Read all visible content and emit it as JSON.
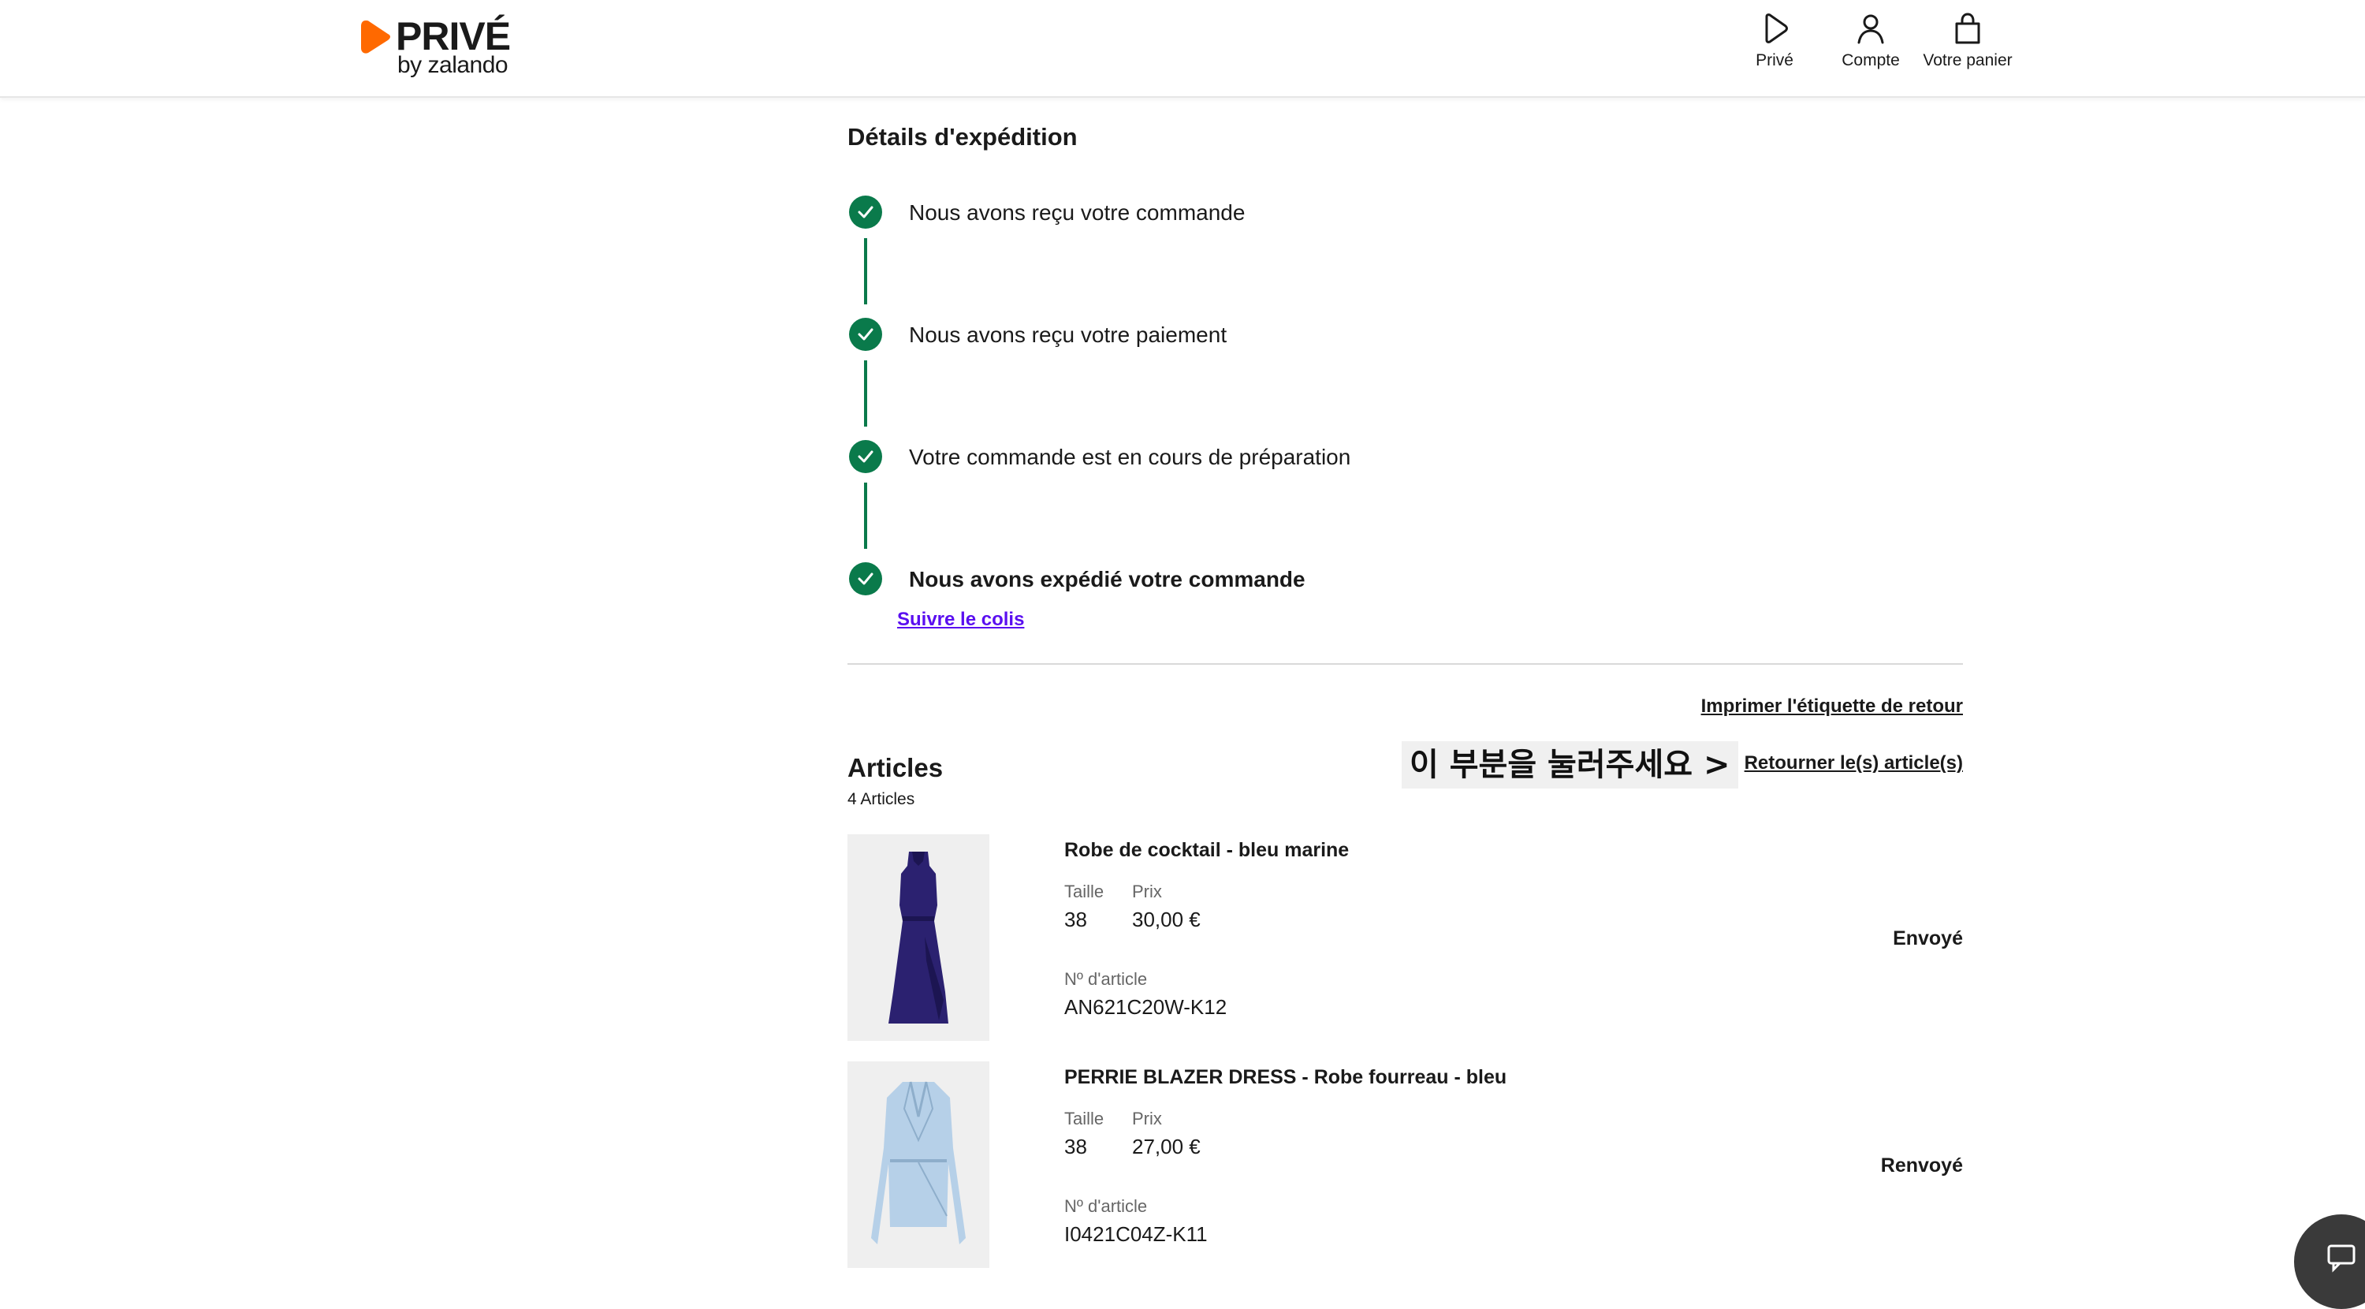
{
  "header": {
    "logo": {
      "brand": "PRIVÉ",
      "sub": "by zalando",
      "color": "#ff6900"
    },
    "nav": [
      {
        "label": "Privé",
        "icon": "prive-play-icon"
      },
      {
        "label": "Compte",
        "icon": "account-icon"
      },
      {
        "label": "Votre panier",
        "icon": "bag-icon"
      }
    ]
  },
  "shipping": {
    "title": "Détails d'expédition",
    "status_color": "#0a7a4b",
    "steps": [
      {
        "label": "Nous avons reçu votre commande",
        "done": true
      },
      {
        "label": "Nous avons reçu votre paiement",
        "done": true
      },
      {
        "label": "Votre commande est en cours de préparation",
        "done": true
      },
      {
        "label": "Nous avons expédié votre commande",
        "done": true
      }
    ],
    "track_link": "Suivre le colis",
    "track_link_color": "#5a0ff0"
  },
  "returns": {
    "print_label": "Imprimer l'étiquette de retour",
    "return_articles": "Retourner le(s) article(s)",
    "annotation": "이 부분을 눌러주세요 >"
  },
  "articles": {
    "title": "Articles",
    "count": "4 Articles",
    "size_label": "Taille",
    "price_label": "Prix",
    "article_no_label": "Nº d'article",
    "items": [
      {
        "name": "Robe de cocktail - bleu marine",
        "size": "38",
        "price": "30,00 €",
        "article_no": "AN621C20W-K12",
        "status": "Envoyé",
        "image": "navy-dress-image"
      },
      {
        "name": "PERRIE BLAZER DRESS - Robe fourreau - bleu",
        "size": "38",
        "price": "27,00 €",
        "article_no": "I0421C04Z-K11",
        "status": "Renvoyé",
        "image": "light-blue-blazer-dress-image"
      }
    ]
  }
}
